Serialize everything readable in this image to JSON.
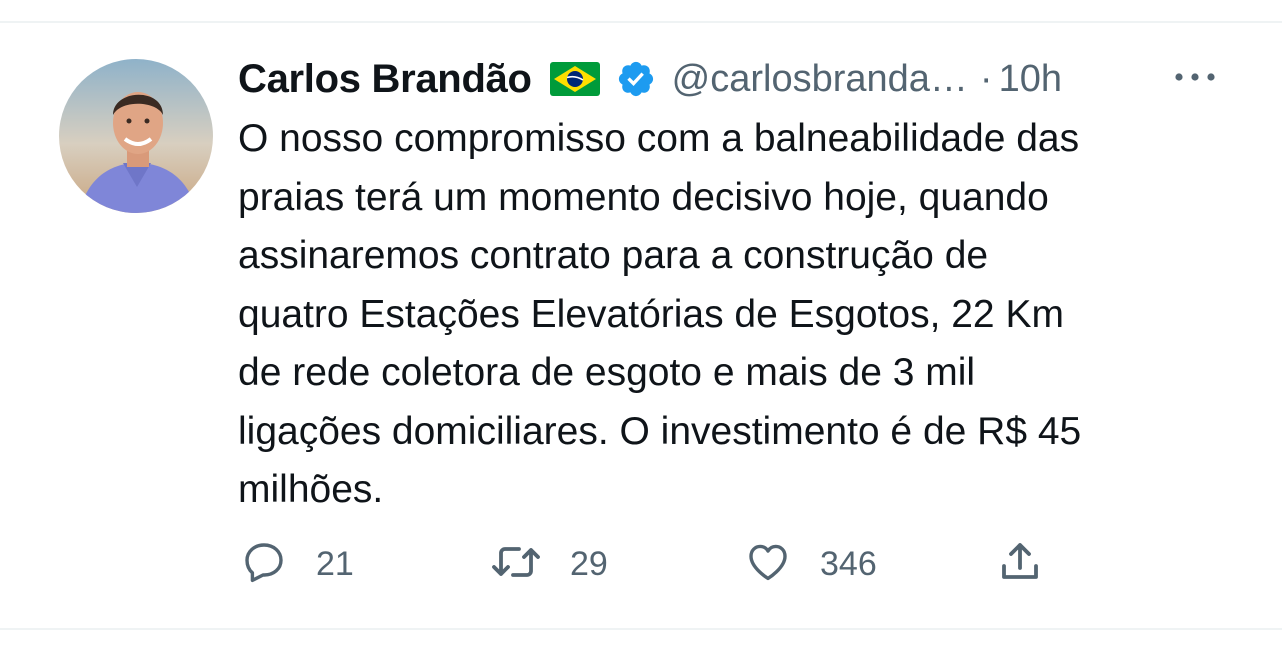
{
  "tweet": {
    "author": {
      "display_name": "Carlos Brandão",
      "handle": "@carlosbranda…",
      "flag_icon": "brazil-flag-icon",
      "verified_icon": "verified-badge-icon"
    },
    "separator": "·",
    "time": "10h",
    "text": "O nosso compromisso com a balneabilidade das\npraias terá um momento decisivo hoje, quando\nassinaremos contrato para a construção de\nquatro Estações Elevatórias de Esgotos, 22 Km\nde rede coletora de esgoto e mais de 3 mil\nligações domiciliares. O investimento é de R$ 45\nmilhões.",
    "actions": {
      "replies": "21",
      "retweets": "29",
      "likes": "346"
    }
  },
  "colors": {
    "text": "#0f1419",
    "secondary": "#536471",
    "verified": "#1d9bf0",
    "divider": "#eff3f4"
  }
}
